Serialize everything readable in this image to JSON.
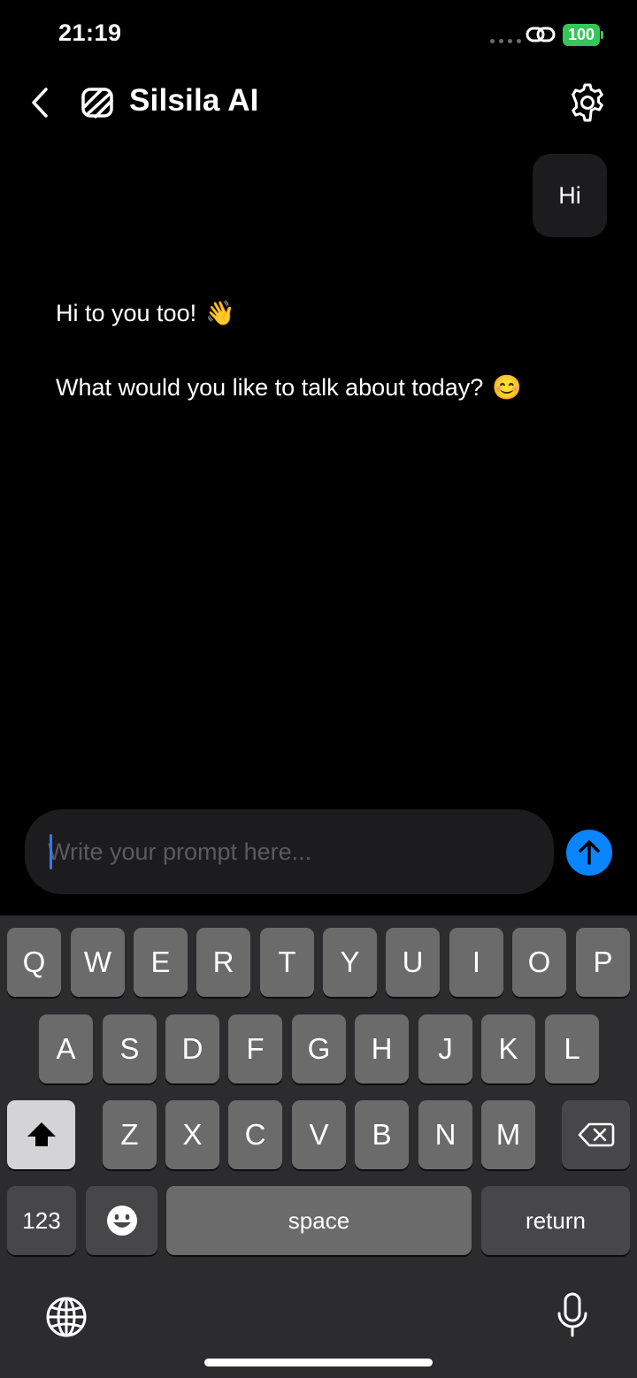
{
  "status_bar": {
    "time": "21:19",
    "battery": "100"
  },
  "header": {
    "title": "Silsila AI"
  },
  "messages": {
    "user": "Hi",
    "ai_line1": "Hi to you too!",
    "ai_line1_emoji": "👋",
    "ai_line2": "What would you like to talk about today?",
    "ai_line2_emoji": "😊"
  },
  "input": {
    "placeholder": "Write your prompt here...",
    "value": ""
  },
  "keyboard": {
    "row1": [
      "Q",
      "W",
      "E",
      "R",
      "T",
      "Y",
      "U",
      "I",
      "O",
      "P"
    ],
    "row2": [
      "A",
      "S",
      "D",
      "F",
      "G",
      "H",
      "J",
      "K",
      "L"
    ],
    "row3": [
      "Z",
      "X",
      "C",
      "V",
      "B",
      "N",
      "M"
    ],
    "numbers_label": "123",
    "space_label": "space",
    "return_label": "return"
  },
  "colors": {
    "accent": "#0a84ff",
    "battery": "#33c759",
    "bubble": "#1c1c1e"
  }
}
